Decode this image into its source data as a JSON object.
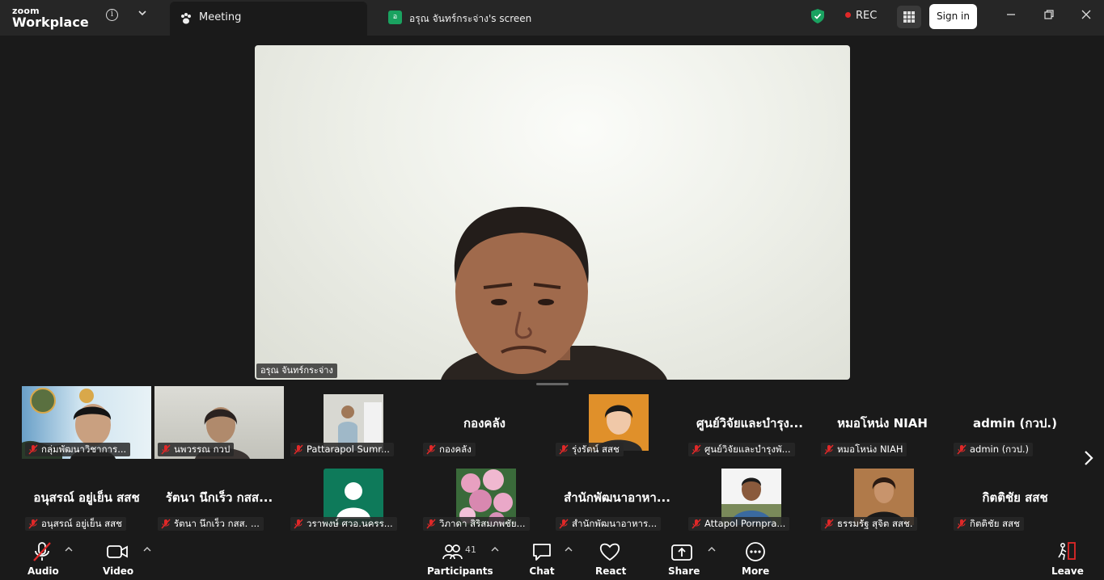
{
  "titlebar": {
    "brand_top": "zoom",
    "brand_bottom": "Workplace",
    "active_tab": "Meeting",
    "share_tab_initial": "อ",
    "share_tab": "อรุณ จันทร์กระจ่าง's screen",
    "rec": "REC",
    "sign_in": "Sign in"
  },
  "main_video": {
    "name": "อรุณ จันทร์กระจ่าง"
  },
  "gallery": {
    "row1": [
      {
        "name": "กลุ่มพัฒนาวิชาการ...",
        "big": ""
      },
      {
        "name": "นพวรรณ กวป",
        "big": ""
      },
      {
        "name": "Pattarapol Sumr...",
        "big": ""
      },
      {
        "name": "กองคลัง",
        "big": "กองคลัง"
      },
      {
        "name": "รุ่งรัตน์ สสช",
        "big": ""
      },
      {
        "name": "ศูนย์วิจัยและบำรุงพั...",
        "big": "ศูนย์วิจัยและบำรุง..."
      },
      {
        "name": "หมอโหน่ง NIAH",
        "big": "หมอโหน่ง NIAH"
      },
      {
        "name": "admin (กวป.)",
        "big": "admin (กวป.)"
      }
    ],
    "row2": [
      {
        "name": "อนุสรณ์ อยู่เย็น สสช",
        "big": "อนุสรณ์ อยู่เย็น สสช"
      },
      {
        "name": "รัตนา นึกเร็ว กสส. ...",
        "big": "รัตนา นึกเร็ว กสส..."
      },
      {
        "name": "วราพงษ์ ศวอ.นครร...",
        "big": ""
      },
      {
        "name": "วิภาดา สิริสมภพชัย...",
        "big": ""
      },
      {
        "name": "สำนักพัฒนาอาหาร...",
        "big": "สำนักพัฒนาอาหา..."
      },
      {
        "name": "Attapol Pornpra...",
        "big": ""
      },
      {
        "name": "ธรรมรัฐ สุจิต สสช.",
        "big": ""
      },
      {
        "name": "กิตติชัย สสช",
        "big": "กิตติชัย สสช"
      }
    ]
  },
  "toolbar": {
    "audio": "Audio",
    "video": "Video",
    "participants": "Participants",
    "participants_count": "41",
    "chat": "Chat",
    "react": "React",
    "share": "Share",
    "more": "More",
    "leave": "Leave"
  },
  "colors": {
    "accent_green": "#1aa260",
    "rec_red": "#e02828",
    "muted_red": "#e02828"
  }
}
